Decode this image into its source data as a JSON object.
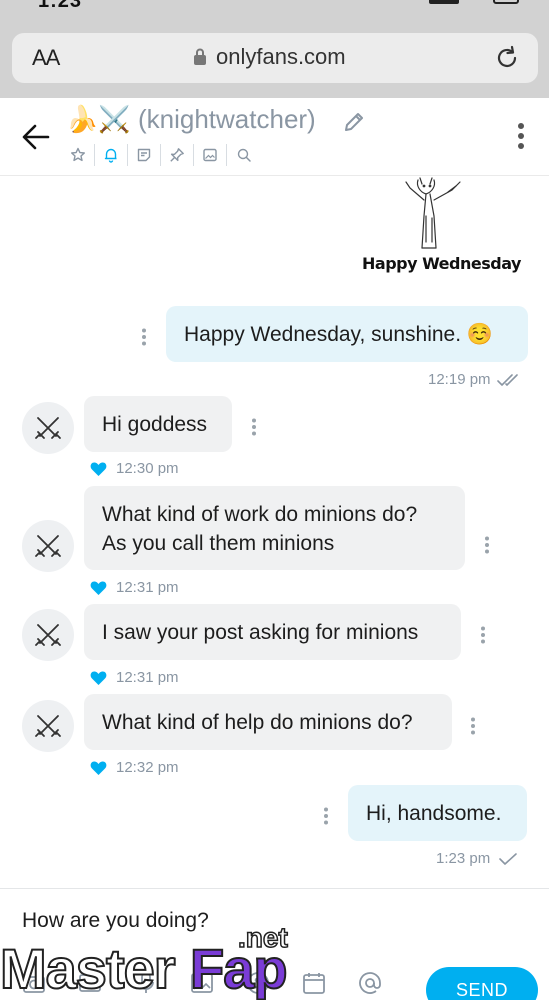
{
  "status_bar": {
    "time": "1:23"
  },
  "browser": {
    "aa_label": "AA",
    "url": "onlyfans.com"
  },
  "chat_header": {
    "emoji": "🍌⚔️",
    "username": "(knightwatcher)",
    "tools": [
      "star-icon",
      "bell-icon",
      "note-icon",
      "pin-icon",
      "image-icon",
      "search-icon"
    ]
  },
  "sticker": {
    "caption": "Happy Wednesday"
  },
  "messages": [
    {
      "direction": "out",
      "text": "Happy Wednesday, sunshine. ☺️",
      "time": "12:19 pm",
      "read": true
    },
    {
      "direction": "in",
      "text": "Hi goddess",
      "time": "12:30 pm",
      "liked": true
    },
    {
      "direction": "in",
      "text_lines": [
        "What kind of work do minions do?",
        "As you call them minions"
      ],
      "time": "12:31 pm",
      "liked": true
    },
    {
      "direction": "in",
      "text": "I saw your post asking for minions",
      "time": "12:31 pm",
      "liked": true
    },
    {
      "direction": "in",
      "text": "What kind of help do minions do?",
      "time": "12:32 pm",
      "liked": true
    },
    {
      "direction": "out",
      "text": "Hi, handsome.",
      "time": "1:23 pm",
      "read": false
    }
  ],
  "composer": {
    "value": "How are you doing?",
    "send_label": "SEND",
    "icons": [
      "camera-icon",
      "gif-icon",
      "microphone-icon",
      "image-icon",
      "dollar-icon",
      "calendar-icon",
      "at-icon"
    ]
  },
  "watermark": {
    "main": "Master",
    "accent": "Fap",
    "suffix": ".net"
  },
  "colors": {
    "accent": "#00aff0",
    "outgoing_bubble": "#e4f4fa",
    "incoming_bubble": "#f0f1f2",
    "muted_text": "#8a96a3"
  }
}
